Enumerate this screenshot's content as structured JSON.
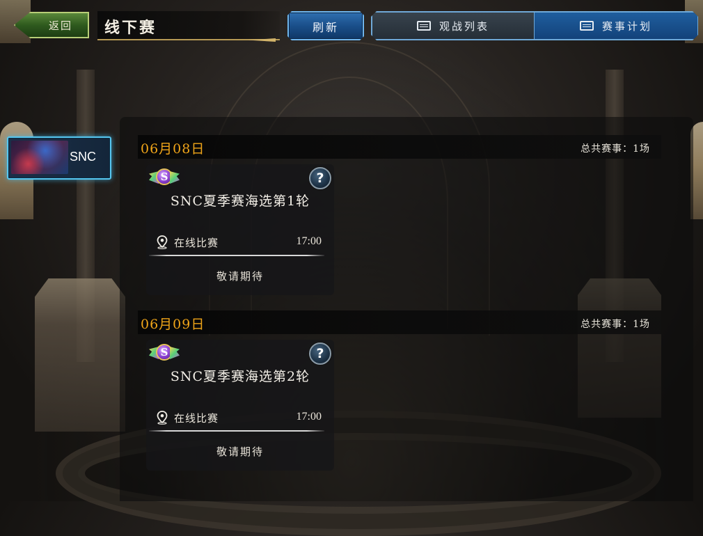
{
  "header": {
    "back_label": "返回",
    "title": "线下赛",
    "refresh_label": "刷新",
    "tabs": [
      {
        "label": "观战列表",
        "icon": "monitor-icon",
        "active": false
      },
      {
        "label": "赛事计划",
        "icon": "monitor-icon",
        "active": true
      }
    ]
  },
  "sidebar": {
    "items": [
      {
        "label": "SNC",
        "selected": true
      }
    ]
  },
  "schedule": [
    {
      "date": "06月08日",
      "total": "总共赛事：1场",
      "matches": [
        {
          "name": "SNC夏季赛海选第1轮",
          "location": "在线比赛",
          "time": "17:00",
          "status": "敬请期待"
        }
      ]
    },
    {
      "date": "06月09日",
      "total": "总共赛事：1场",
      "matches": [
        {
          "name": "SNC夏季赛海选第2轮",
          "location": "在线比赛",
          "time": "17:00",
          "status": "敬请期待"
        }
      ]
    }
  ],
  "colors": {
    "date_accent": "#f0a519",
    "blue_button": "#1a4f8a",
    "back_button": "#2f5a1e",
    "selected_glow": "#56c6f0"
  }
}
